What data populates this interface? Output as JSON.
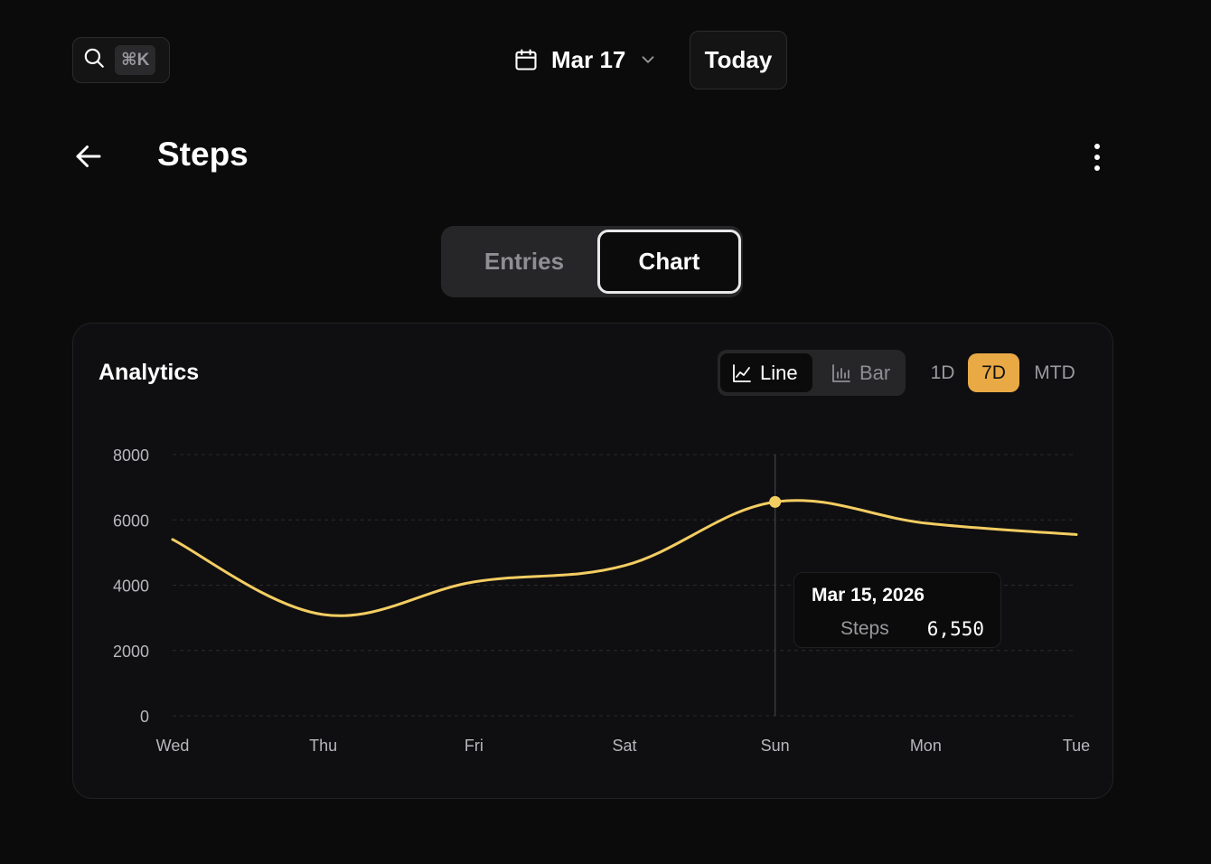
{
  "search": {
    "shortcut": "⌘K",
    "icon": "search-icon"
  },
  "date_picker": {
    "label": "Mar 17",
    "icon": "calendar-icon"
  },
  "today_label": "Today",
  "page": {
    "title": "Steps"
  },
  "view_tabs": [
    {
      "label": "Entries",
      "active": false
    },
    {
      "label": "Chart",
      "active": true
    }
  ],
  "analytics": {
    "title": "Analytics",
    "chart_types": [
      {
        "label": "Line",
        "icon": "line-chart-icon",
        "active": true
      },
      {
        "label": "Bar",
        "icon": "bar-chart-icon",
        "active": false
      }
    ],
    "ranges": [
      {
        "label": "1D",
        "active": false
      },
      {
        "label": "7D",
        "active": true
      },
      {
        "label": "MTD",
        "active": false
      }
    ]
  },
  "tooltip": {
    "date": "Mar 15, 2026",
    "label": "Steps",
    "value": "6,550"
  },
  "colors": {
    "accent": "#e9a945",
    "line": "#f4cd62",
    "background": "#0b0b0c",
    "card": "#0f0f11"
  },
  "chart_data": {
    "type": "line",
    "categories": [
      "Wed",
      "Thu",
      "Fri",
      "Sat",
      "Sun",
      "Mon",
      "Tue"
    ],
    "series": [
      {
        "values": [
          5400,
          3100,
          4100,
          4600,
          6550,
          5900,
          5550
        ]
      }
    ],
    "ylim": [
      0,
      8000
    ],
    "yticks": [
      0,
      2000,
      4000,
      6000,
      8000
    ],
    "grid": true,
    "highlight_index": 4
  }
}
